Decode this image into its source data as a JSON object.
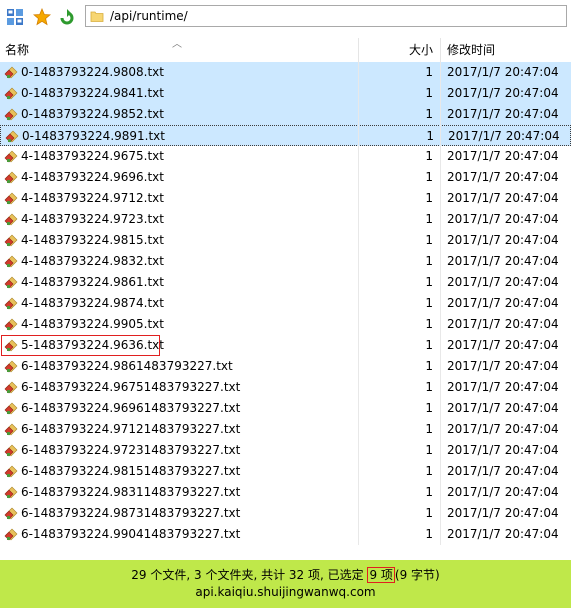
{
  "toolbar": {
    "icons": [
      "computer-icon",
      "favorite-star-icon",
      "refresh-icon"
    ],
    "path": "/api/runtime/"
  },
  "columns": {
    "name": "名称",
    "size": "大小",
    "modified": "修改时间"
  },
  "files": [
    {
      "name": "0-1483793224.9808.txt",
      "size": "1",
      "modified": "2017/1/7 20:47:04",
      "state": "selected"
    },
    {
      "name": "0-1483793224.9841.txt",
      "size": "1",
      "modified": "2017/1/7 20:47:04",
      "state": "selected"
    },
    {
      "name": "0-1483793224.9852.txt",
      "size": "1",
      "modified": "2017/1/7 20:47:04",
      "state": "selected"
    },
    {
      "name": "0-1483793224.9891.txt",
      "size": "1",
      "modified": "2017/1/7 20:47:04",
      "state": "focused"
    },
    {
      "name": "4-1483793224.9675.txt",
      "size": "1",
      "modified": "2017/1/7 20:47:04",
      "state": "normal"
    },
    {
      "name": "4-1483793224.9696.txt",
      "size": "1",
      "modified": "2017/1/7 20:47:04",
      "state": "normal"
    },
    {
      "name": "4-1483793224.9712.txt",
      "size": "1",
      "modified": "2017/1/7 20:47:04",
      "state": "normal"
    },
    {
      "name": "4-1483793224.9723.txt",
      "size": "1",
      "modified": "2017/1/7 20:47:04",
      "state": "normal"
    },
    {
      "name": "4-1483793224.9815.txt",
      "size": "1",
      "modified": "2017/1/7 20:47:04",
      "state": "normal"
    },
    {
      "name": "4-1483793224.9832.txt",
      "size": "1",
      "modified": "2017/1/7 20:47:04",
      "state": "normal"
    },
    {
      "name": "4-1483793224.9861.txt",
      "size": "1",
      "modified": "2017/1/7 20:47:04",
      "state": "normal"
    },
    {
      "name": "4-1483793224.9874.txt",
      "size": "1",
      "modified": "2017/1/7 20:47:04",
      "state": "normal"
    },
    {
      "name": "4-1483793224.9905.txt",
      "size": "1",
      "modified": "2017/1/7 20:47:04",
      "state": "normal"
    },
    {
      "name": "5-1483793224.9636.txt",
      "size": "1",
      "modified": "2017/1/7 20:47:04",
      "state": "highlighted"
    },
    {
      "name": "6-1483793224.9861483793227.txt",
      "size": "1",
      "modified": "2017/1/7 20:47:04",
      "state": "normal"
    },
    {
      "name": "6-1483793224.96751483793227.txt",
      "size": "1",
      "modified": "2017/1/7 20:47:04",
      "state": "normal"
    },
    {
      "name": "6-1483793224.96961483793227.txt",
      "size": "1",
      "modified": "2017/1/7 20:47:04",
      "state": "normal"
    },
    {
      "name": "6-1483793224.97121483793227.txt",
      "size": "1",
      "modified": "2017/1/7 20:47:04",
      "state": "normal"
    },
    {
      "name": "6-1483793224.97231483793227.txt",
      "size": "1",
      "modified": "2017/1/7 20:47:04",
      "state": "normal"
    },
    {
      "name": "6-1483793224.98151483793227.txt",
      "size": "1",
      "modified": "2017/1/7 20:47:04",
      "state": "normal"
    },
    {
      "name": "6-1483793224.98311483793227.txt",
      "size": "1",
      "modified": "2017/1/7 20:47:04",
      "state": "normal"
    },
    {
      "name": "6-1483793224.98731483793227.txt",
      "size": "1",
      "modified": "2017/1/7 20:47:04",
      "state": "normal"
    },
    {
      "name": "6-1483793224.99041483793227.txt",
      "size": "1",
      "modified": "2017/1/7 20:47:04",
      "state": "normal"
    }
  ],
  "status": {
    "summary_before": "29 个文件, 3 个文件夹, 共计 32 项, 已选定",
    "selected_count": "9 项",
    "summary_after": "(9 字节)",
    "host": "api.kaiqiu.shuijingwanwq.com"
  },
  "colors": {
    "selection": "#cce8ff",
    "status_bar": "#bfe84a",
    "highlight_border": "#e02020"
  }
}
